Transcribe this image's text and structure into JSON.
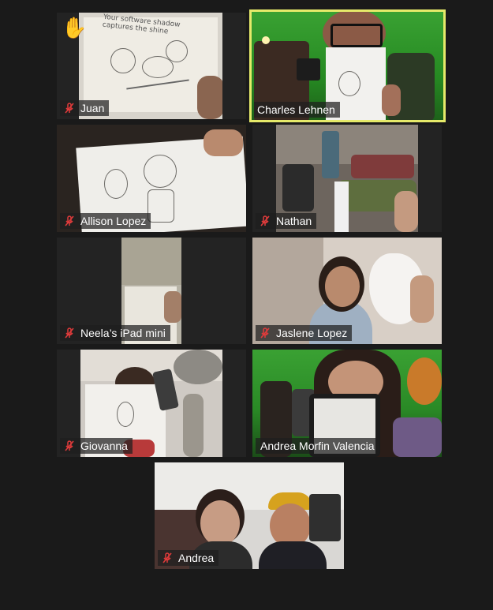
{
  "participants": [
    {
      "name": "Juan",
      "muted": true,
      "hand_raised": true,
      "active_speaker": false
    },
    {
      "name": "Charles Lehnen",
      "muted": false,
      "hand_raised": false,
      "active_speaker": true
    },
    {
      "name": "Allison Lopez",
      "muted": true,
      "hand_raised": false,
      "active_speaker": false
    },
    {
      "name": "Nathan",
      "muted": true,
      "hand_raised": false,
      "active_speaker": false
    },
    {
      "name": "Neela’s iPad mini",
      "muted": true,
      "hand_raised": false,
      "active_speaker": false
    },
    {
      "name": "Jaslene Lopez",
      "muted": true,
      "hand_raised": false,
      "active_speaker": false
    },
    {
      "name": "Giovanna",
      "muted": true,
      "hand_raised": false,
      "active_speaker": false
    },
    {
      "name": "Andrea Morfin Valencia",
      "muted": false,
      "hand_raised": false,
      "active_speaker": false
    },
    {
      "name": "Andrea",
      "muted": true,
      "hand_raised": false,
      "active_speaker": false
    }
  ],
  "drawing_text": "Your software shadow captures the shine",
  "colors": {
    "background": "#1a1a1a",
    "tile": "#232323",
    "active_border": "#e6ea6a",
    "mute_red": "#e03b3b",
    "nametag_text": "#ffffff"
  },
  "icons": {
    "mute": "microphone-muted-icon",
    "hand": "raised-hand-icon"
  }
}
